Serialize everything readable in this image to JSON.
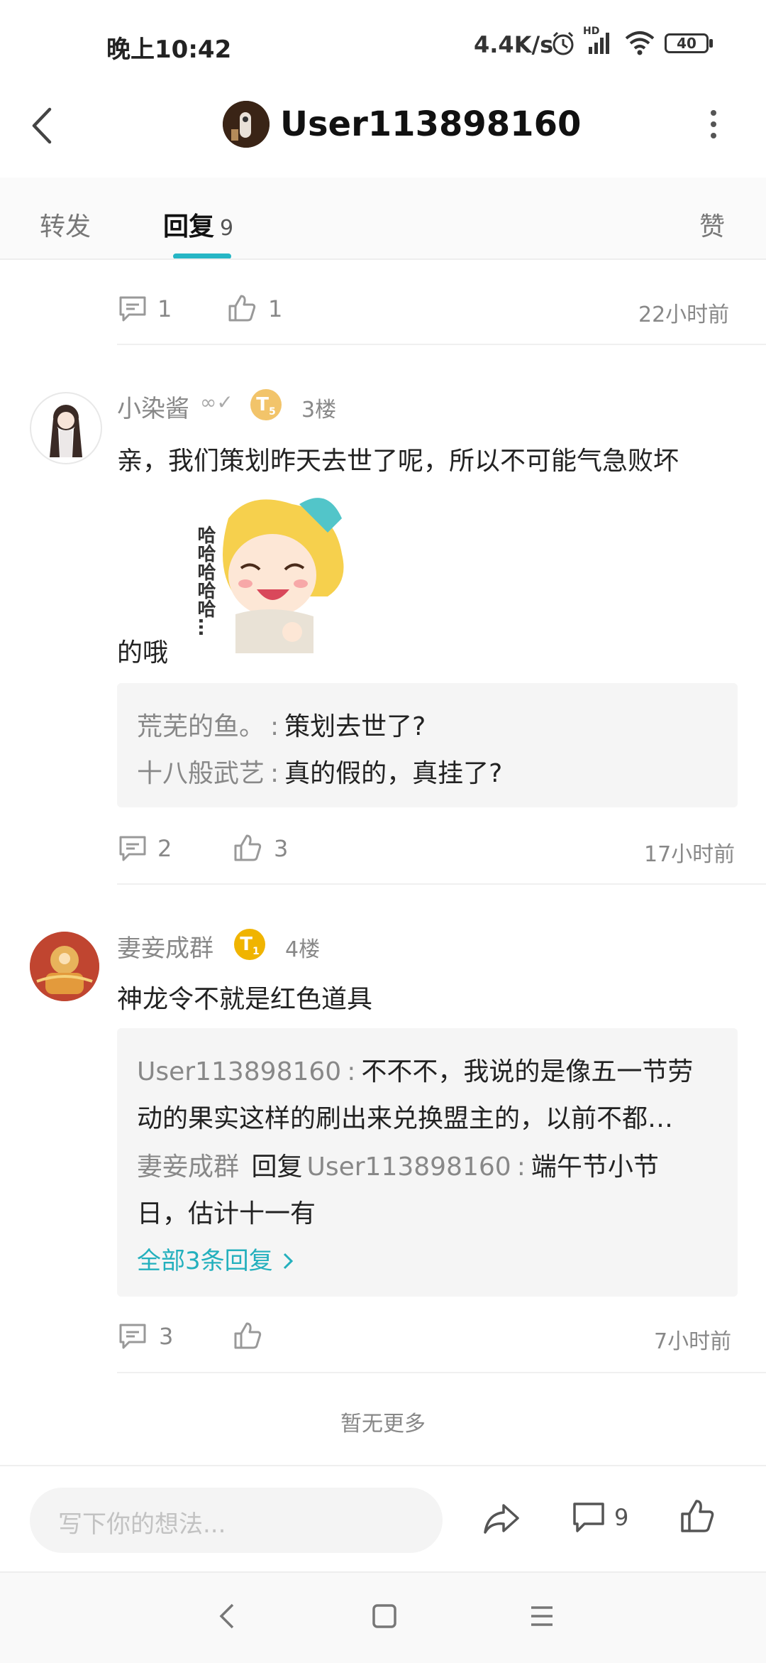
{
  "status": {
    "time": "晚上10:42",
    "speed": "4.4K/s",
    "hd_label": "HD",
    "battery": "40"
  },
  "header": {
    "title": "User113898160"
  },
  "tabs": [
    {
      "label": "转发"
    },
    {
      "label": "回复",
      "count": "9"
    },
    {
      "label": "赞"
    }
  ],
  "top_actions": {
    "comment_count": "1",
    "like_count": "1",
    "time": "22小时前"
  },
  "replies": [
    {
      "name": "小染酱",
      "badge_level": "5",
      "floor": "3楼",
      "content_line1": "亲，我们策划昨天去世了呢，所以不可能气急败坏",
      "content_line2": "的哦",
      "sticker_text": "哈哈哈哈哈…",
      "quotes": [
        {
          "name": "荒芜的鱼。",
          "sep": ":",
          "text": "策划去世了?"
        },
        {
          "name": "十八般武艺",
          "sep": ":",
          "text": "真的假的，真挂了?"
        }
      ],
      "comment_count": "2",
      "like_count": "3",
      "time": "17小时前"
    },
    {
      "name": "妻妾成群",
      "badge_level": "1",
      "floor": "4楼",
      "content": "神龙令不就是红色道具",
      "quotes": [
        {
          "name": "User113898160",
          "sep": ":",
          "text_line1": "不不不，我说的是像五一节劳",
          "text_line2": "动的果实这样的刷出来兑换盟主的，以前不都…"
        },
        {
          "name": "妻妾成群",
          "reply_word": "回复",
          "target": "User113898160",
          "sep": ":",
          "text_line1": "端午节小节",
          "text_line2": "日，估计十一有"
        }
      ],
      "all_replies": "全部3条回复",
      "comment_count": "3",
      "time": "7小时前"
    }
  ],
  "no_more": "暂无更多",
  "bottom": {
    "input_placeholder": "写下你的想法...",
    "comment_count": "9"
  },
  "colors": {
    "accent": "#26b6c5",
    "link": "#23b0bd"
  }
}
